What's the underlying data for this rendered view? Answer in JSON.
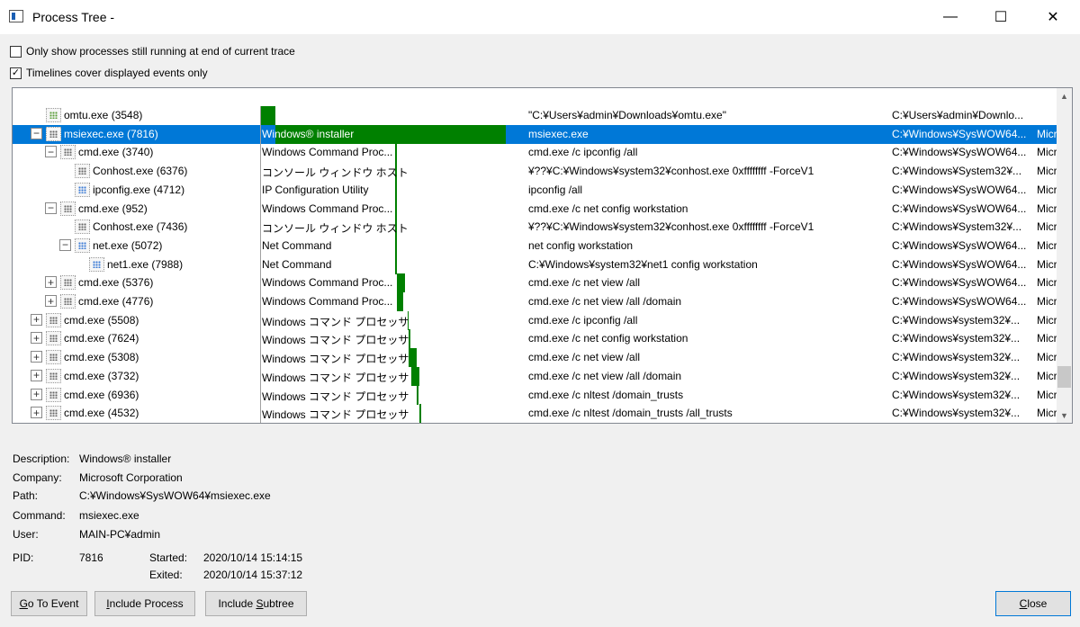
{
  "window": {
    "title": "Process Tree -",
    "minimize_glyph": "—",
    "maximize_glyph": "☐",
    "close_glyph": "✕"
  },
  "options": {
    "only_running": {
      "label": "Only show processes still running at end of current trace",
      "checked": false
    },
    "timelines": {
      "label": "Timelines cover displayed events only",
      "checked": true
    }
  },
  "glyphs": {
    "check": "✓",
    "collapse": "−",
    "expand": "+"
  },
  "tree": {
    "rows": [
      {
        "name": "omtu.exe (3548)",
        "desc": "",
        "cmd": "\"C:¥Users¥admin¥Downloads¥omtu.exe\"",
        "path": "C:¥Users¥admin¥Downlo...",
        "company": "",
        "indent": 0,
        "expander": "none",
        "selected": false,
        "icon": "green",
        "timeline": {
          "start": 0.0,
          "end": 0.055
        }
      },
      {
        "name": "msiexec.exe (7816)",
        "desc": "Windows® installer",
        "cmd": "msiexec.exe",
        "path": "C:¥Windows¥SysWOW64...",
        "company": "Micro",
        "indent": 0,
        "expander": "collapse",
        "selected": true,
        "icon": "gray",
        "timeline": {
          "start": 0.055,
          "end": 0.91
        }
      },
      {
        "name": "cmd.exe (3740)",
        "desc": "Windows Command Proc...",
        "cmd": "cmd.exe /c ipconfig /all",
        "path": "C:¥Windows¥SysWOW64...",
        "company": "Micro",
        "indent": 1,
        "expander": "collapse",
        "selected": false,
        "icon": "gray",
        "timeline": {
          "start": 0.5,
          "end": 0.505
        }
      },
      {
        "name": "Conhost.exe (6376)",
        "desc": "コンソール ウィンドウ ホスト",
        "cmd": "¥??¥C:¥Windows¥system32¥conhost.exe 0xffffffff -ForceV1",
        "path": "C:¥Windows¥System32¥...",
        "company": "Micro",
        "indent": 2,
        "expander": "none",
        "selected": false,
        "icon": "gray",
        "timeline": {
          "start": 0.5,
          "end": 0.505
        }
      },
      {
        "name": "ipconfig.exe (4712)",
        "desc": "IP Configuration Utility",
        "cmd": "ipconfig  /all",
        "path": "C:¥Windows¥SysWOW64...",
        "company": "Micro",
        "indent": 2,
        "expander": "none",
        "selected": false,
        "icon": "blue",
        "timeline": {
          "start": 0.5,
          "end": 0.505
        }
      },
      {
        "name": "cmd.exe (952)",
        "desc": "Windows Command Proc...",
        "cmd": "cmd.exe /c net config workstation",
        "path": "C:¥Windows¥SysWOW64...",
        "company": "Micro",
        "indent": 1,
        "expander": "collapse",
        "selected": false,
        "icon": "gray",
        "timeline": {
          "start": 0.5,
          "end": 0.505
        }
      },
      {
        "name": "Conhost.exe (7436)",
        "desc": "コンソール ウィンドウ ホスト",
        "cmd": "¥??¥C:¥Windows¥system32¥conhost.exe 0xffffffff -ForceV1",
        "path": "C:¥Windows¥System32¥...",
        "company": "Micro",
        "indent": 2,
        "expander": "none",
        "selected": false,
        "icon": "gray",
        "timeline": {
          "start": 0.5,
          "end": 0.505
        }
      },
      {
        "name": "net.exe (5072)",
        "desc": "Net Command",
        "cmd": "net  config workstation",
        "path": "C:¥Windows¥SysWOW64...",
        "company": "Micro",
        "indent": 2,
        "expander": "collapse",
        "selected": false,
        "icon": "blue",
        "timeline": {
          "start": 0.5,
          "end": 0.505
        }
      },
      {
        "name": "net1.exe (7988)",
        "desc": "Net Command",
        "cmd": "C:¥Windows¥system32¥net1  config workstation",
        "path": "C:¥Windows¥SysWOW64...",
        "company": "Micro",
        "indent": 3,
        "expander": "none",
        "selected": false,
        "icon": "blue",
        "timeline": {
          "start": 0.5,
          "end": 0.505
        }
      },
      {
        "name": "cmd.exe (5376)",
        "desc": "Windows Command Proc...",
        "cmd": "cmd.exe /c net view /all",
        "path": "C:¥Windows¥SysWOW64...",
        "company": "Micro",
        "indent": 1,
        "expander": "expand",
        "selected": false,
        "icon": "gray",
        "timeline": {
          "start": 0.505,
          "end": 0.535
        }
      },
      {
        "name": "cmd.exe (4776)",
        "desc": "Windows Command Proc...",
        "cmd": "cmd.exe /c net view /all /domain",
        "path": "C:¥Windows¥SysWOW64...",
        "company": "Micro",
        "indent": 1,
        "expander": "expand",
        "selected": false,
        "icon": "gray",
        "timeline": {
          "start": 0.505,
          "end": 0.53
        }
      },
      {
        "name": "cmd.exe (5508)",
        "desc": "Windows コマンド プロセッサ",
        "cmd": "cmd.exe /c ipconfig /all",
        "path": "C:¥Windows¥system32¥...",
        "company": "Micro",
        "indent": 0,
        "expander": "expand",
        "selected": false,
        "icon": "gray",
        "timeline": {
          "start": 0.545,
          "end": 0.55
        }
      },
      {
        "name": "cmd.exe (7624)",
        "desc": "Windows コマンド プロセッサ",
        "cmd": "cmd.exe /c net config workstation",
        "path": "C:¥Windows¥system32¥...",
        "company": "Micro",
        "indent": 0,
        "expander": "expand",
        "selected": false,
        "icon": "gray",
        "timeline": {
          "start": 0.55,
          "end": 0.555
        }
      },
      {
        "name": "cmd.exe (5308)",
        "desc": "Windows コマンド プロセッサ",
        "cmd": "cmd.exe /c net view /all",
        "path": "C:¥Windows¥system32¥...",
        "company": "Micro",
        "indent": 0,
        "expander": "expand",
        "selected": false,
        "icon": "gray",
        "timeline": {
          "start": 0.55,
          "end": 0.58
        }
      },
      {
        "name": "cmd.exe (3732)",
        "desc": "Windows コマンド プロセッサ",
        "cmd": "cmd.exe /c net view /all /domain",
        "path": "C:¥Windows¥system32¥...",
        "company": "Micro",
        "indent": 0,
        "expander": "expand",
        "selected": false,
        "icon": "gray",
        "timeline": {
          "start": 0.56,
          "end": 0.59
        }
      },
      {
        "name": "cmd.exe (6936)",
        "desc": "Windows コマンド プロセッサ",
        "cmd": "cmd.exe /c nltest /domain_trusts",
        "path": "C:¥Windows¥system32¥...",
        "company": "Micro",
        "indent": 0,
        "expander": "expand",
        "selected": false,
        "icon": "gray",
        "timeline": {
          "start": 0.58,
          "end": 0.585
        }
      },
      {
        "name": "cmd.exe (4532)",
        "desc": "Windows コマンド プロセッサ",
        "cmd": "cmd.exe /c nltest /domain_trusts /all_trusts",
        "path": "C:¥Windows¥system32¥...",
        "company": "Micro",
        "indent": 0,
        "expander": "expand",
        "selected": false,
        "icon": "gray",
        "timeline": {
          "start": 0.59,
          "end": 0.595
        }
      }
    ]
  },
  "scrollbar": {
    "up_glyph": "▲",
    "down_glyph": "▼",
    "position": 0.93
  },
  "details": {
    "description_label": "Description:",
    "description": "Windows® installer",
    "company_label": "Company:",
    "company": "Microsoft Corporation",
    "path_label": "Path:",
    "path": "C:¥Windows¥SysWOW64¥msiexec.exe",
    "command_label": "Command:",
    "command": "msiexec.exe",
    "user_label": "User:",
    "user": "MAIN-PC¥admin",
    "pid_label": "PID:",
    "pid": "7816",
    "started_label": "Started:",
    "started": "2020/10/14 15:14:15",
    "exited_label": "Exited:",
    "exited": "2020/10/14 15:37:12"
  },
  "buttons": {
    "go_to_event": {
      "mnemonic": "G",
      "rest": "o To Event"
    },
    "include_process": {
      "mnemonic": "I",
      "rest": "nclude Process"
    },
    "include_subtree": {
      "pre": "Include ",
      "mnemonic": "S",
      "rest": "ubtree"
    },
    "close": {
      "mnemonic": "C",
      "rest": "lose"
    }
  }
}
